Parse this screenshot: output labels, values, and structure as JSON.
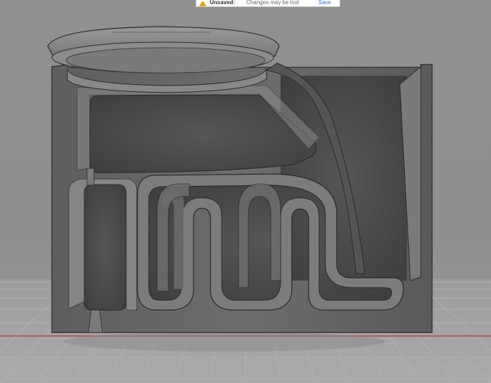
{
  "notice": {
    "title": "Unsaved:",
    "message": "Changes may be lost",
    "save_label": "Save"
  },
  "colors": {
    "background": "#8f8f8f",
    "body": "#6a6a6a",
    "cavity": "#4d4d4d",
    "grid": "#a9a9a9",
    "x_axis": "#c23b3b",
    "warning": "#e6a100",
    "link": "#1f7ad6"
  },
  "icons": [
    "warning-icon"
  ]
}
